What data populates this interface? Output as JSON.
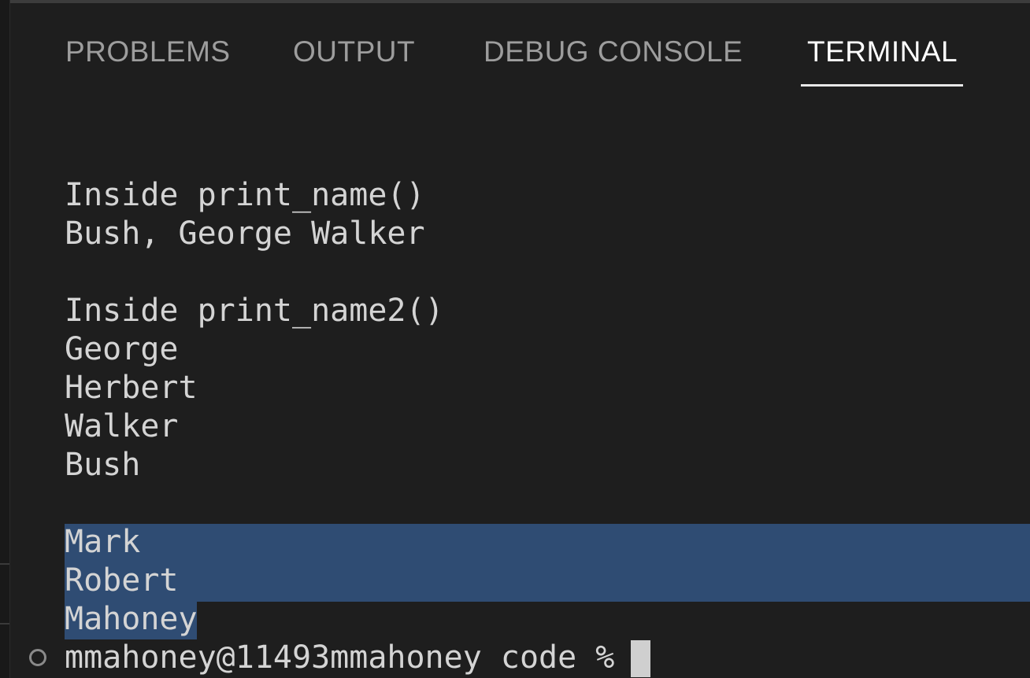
{
  "tabs": [
    {
      "label": "PROBLEMS",
      "active": false
    },
    {
      "label": "OUTPUT",
      "active": false
    },
    {
      "label": "DEBUG CONSOLE",
      "active": false
    },
    {
      "label": "TERMINAL",
      "active": true
    }
  ],
  "terminal": {
    "lines": [
      "Inside print_name()",
      "Bush, George Walker",
      "",
      "Inside print_name2()",
      "George",
      "Herbert",
      "Walker",
      "Bush",
      "",
      "Mark",
      "Robert",
      "Mahoney"
    ],
    "selected_lines": [
      "Mark",
      "Robert",
      "Mahoney"
    ],
    "prompt": "mmahoney@11493mmahoney code % "
  },
  "colors": {
    "background": "#1e1e1e",
    "selection": "#2f4c73",
    "text": "#d4d4d4",
    "tab_inactive": "#9d9d9d",
    "tab_active": "#ffffff"
  }
}
